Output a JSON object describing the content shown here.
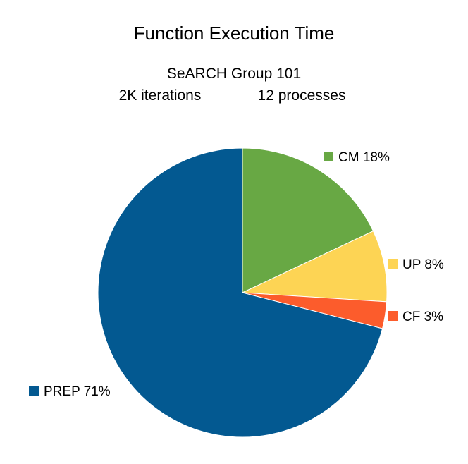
{
  "chart_data": {
    "type": "pie",
    "title": "Function Execution Time",
    "subtitle_line1": "SeARCH Group 101",
    "subtitle_line2_left": "2K iterations",
    "subtitle_line2_right": "12 processes",
    "slices": [
      {
        "name": "CM",
        "value": 18,
        "label": "CM 18%",
        "color": "#68a844"
      },
      {
        "name": "UP",
        "value": 8,
        "label": "UP 8%",
        "color": "#fdd454"
      },
      {
        "name": "CF",
        "value": 3,
        "label": "CF 3%",
        "color": "#fc5c2c"
      },
      {
        "name": "PREP",
        "value": 71,
        "label": "PREP 71%",
        "color": "#035991"
      }
    ],
    "legend": "labels beside slices"
  }
}
